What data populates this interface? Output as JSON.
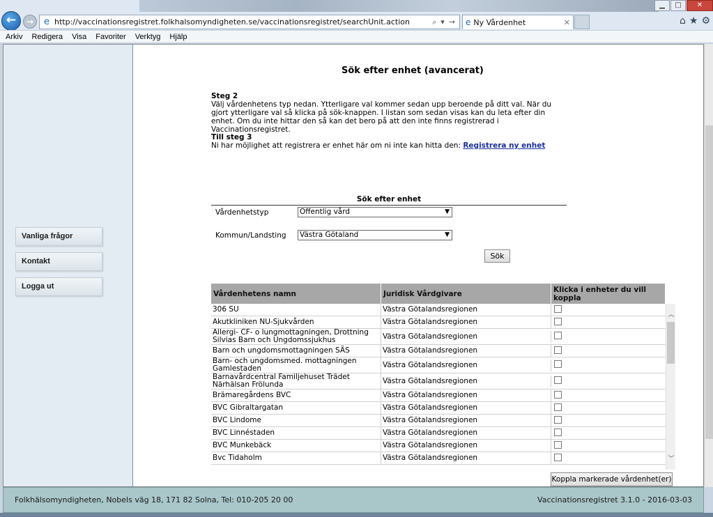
{
  "browser": {
    "url": "http://vaccinationsregistret.folkhalsomyndigheten.se/vaccinationsregistret/searchUnit.action",
    "tab_title": "Ny Vårdenhet",
    "menu": [
      "Arkiv",
      "Redigera",
      "Visa",
      "Favoriter",
      "Verktyg",
      "Hjälp"
    ]
  },
  "sidebar": {
    "items": [
      {
        "label": "Vanliga frågor"
      },
      {
        "label": "Kontakt"
      },
      {
        "label": "Logga ut"
      }
    ]
  },
  "main": {
    "title": "Sök efter enhet (avancerat)",
    "step2_heading": "Steg 2",
    "step2_text": "Välj vårdenhetens typ nedan. Ytterligare val kommer sedan upp beroende på ditt val. När du gjort ytterligare val så klicka på sök-knappen. I listan som sedan visas kan du leta efter din enhet. Om du inte hittar den så kan det bero på att den inte finns registrerad i Vaccinationsregistret.",
    "step3_heading": "Till steg 3",
    "step3_text": "Ni har möjlighet att registrera er enhet här om ni inte kan hitta den: ",
    "register_link": "Registrera ny enhet",
    "search": {
      "heading": "Sök efter enhet",
      "type_label": "Vårdenhetstyp",
      "type_value": "Offentlig vård",
      "region_label": "Kommun/Landsting",
      "region_value": "Västra Götaland",
      "search_button": "Sök"
    },
    "table": {
      "headers": [
        "Vårdenhetens namn",
        "Juridisk Vårdgivare",
        "Klicka i enheter du vill koppla"
      ],
      "rows": [
        {
          "name": "306 SU",
          "provider": "Västra Götalandsregionen"
        },
        {
          "name": "Akutkliniken NU-Sjukvården",
          "provider": "Västra Götalandsregionen"
        },
        {
          "name": "Allergi- CF- o lungmottagningen, Drottning Silvias Barn och Ungdomssjukhus",
          "provider": "Västra Götalandsregionen"
        },
        {
          "name": "Barn och ungdomsmottagningen SÄS",
          "provider": "Västra Götalandsregionen"
        },
        {
          "name": "Barn- och ungdomsmed. mottagningen Gamlestaden",
          "provider": "Västra Götalandsregionen"
        },
        {
          "name": "Barnavårdcentral Familjehuset Trädet Närhälsan Frölunda",
          "provider": "Västra Götalandsregionen"
        },
        {
          "name": "Brämaregårdens BVC",
          "provider": "Västra Götalandsregionen"
        },
        {
          "name": "BVC Gibraltargatan",
          "provider": "Västra Götalandsregionen"
        },
        {
          "name": "BVC Lindome",
          "provider": "Västra Götalandsregionen"
        },
        {
          "name": "BVC Linnéstaden",
          "provider": "Västra Götalandsregionen"
        },
        {
          "name": "BVC Munkebäck",
          "provider": "Västra Götalandsregionen"
        },
        {
          "name": "Bvc Tidaholm",
          "provider": "Västra Götalandsregionen"
        }
      ]
    },
    "connect_button": "Koppla markerade vårdenhet(er)"
  },
  "footer": {
    "address": "Folkhälsomyndigheten, Nobels väg 18, 171 82 Solna, Tel: 010-205 20 00",
    "version": "Vaccinationsregistret 3.1.0 - 2016-03-03"
  }
}
